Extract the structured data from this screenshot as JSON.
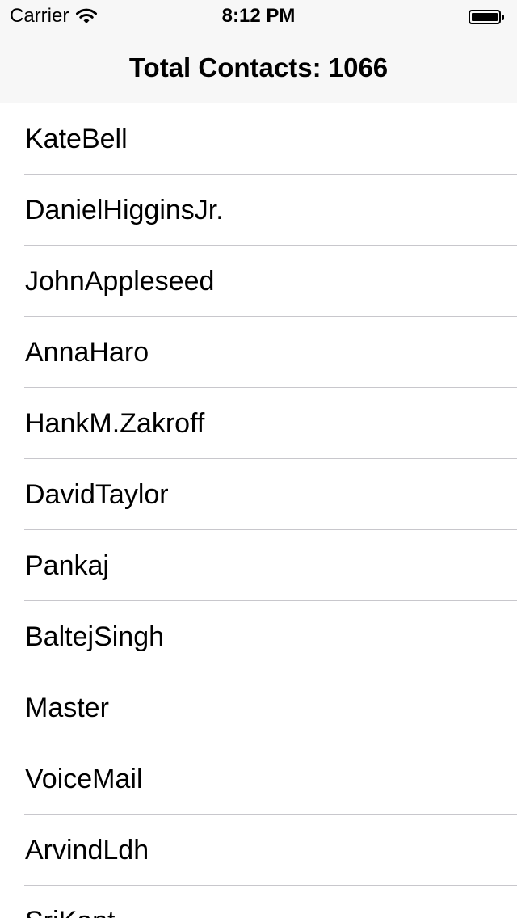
{
  "status_bar": {
    "carrier": "Carrier",
    "time": "8:12 PM",
    "wifi_icon": "wifi-icon",
    "battery_icon": "battery-icon",
    "battery_level": 1.0
  },
  "nav": {
    "title": "Total Contacts: 1066"
  },
  "contacts": [
    "KateBell",
    "DanielHigginsJr.",
    "JohnAppleseed",
    "AnnaHaro",
    "HankM.Zakroff",
    "DavidTaylor",
    "Pankaj",
    "BaltejSingh",
    "Master",
    "VoiceMail",
    "ArvindLdh",
    "SriKant"
  ],
  "colors": {
    "nav_background": "#f7f7f7",
    "separator": "#c8c7cc",
    "text": "#000000"
  }
}
